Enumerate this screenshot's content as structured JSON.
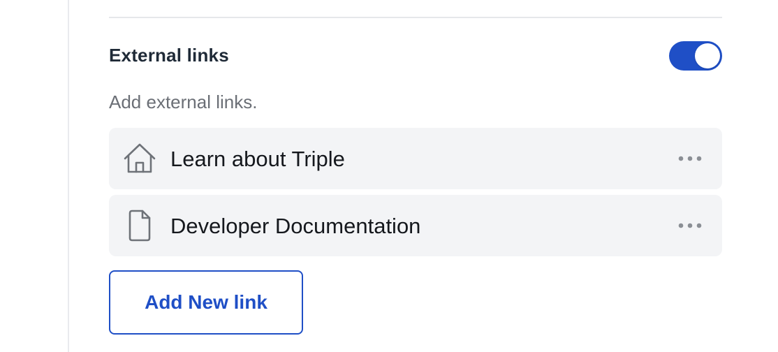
{
  "section": {
    "title": "External links",
    "description": "Add external links.",
    "toggle": {
      "enabled": true,
      "accent": "#1f4fc6"
    }
  },
  "links": [
    {
      "label": "Learn about Triple",
      "icon": "home-icon"
    },
    {
      "label": "Developer Documentation",
      "icon": "document-icon"
    }
  ],
  "actions": {
    "add_label": "Add New link"
  },
  "colors": {
    "accent": "#1f4fc6",
    "item_background": "#f3f4f6",
    "title_text": "#1f2a37",
    "muted_text": "#6b6f76"
  }
}
